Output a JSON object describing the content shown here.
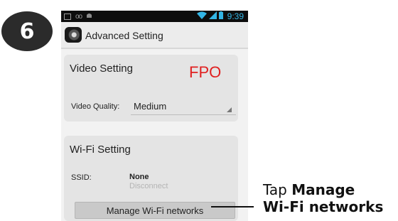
{
  "step_number": "6",
  "statusbar": {
    "left_icons": [
      "picture-icon",
      "voicemail-icon",
      "android-debug-icon"
    ],
    "right_icons": [
      "wifi-icon",
      "signal-icon",
      "battery-icon"
    ],
    "voicemail_glyph": "oo",
    "time": "9:39"
  },
  "actionbar": {
    "title": "Advanced Setting"
  },
  "video_setting": {
    "title": "Video Setting",
    "fpo": "FPO",
    "quality_label": "Video Quality:",
    "quality_value": "Medium"
  },
  "wifi_setting": {
    "title": "Wi-Fi Setting",
    "ssid_label": "SSID:",
    "ssid_value": "None",
    "ssid_action": "Disconnect",
    "manage_button": "Manage Wi-Fi networks"
  },
  "callout": {
    "prefix": "Tap ",
    "bold_1": "Manage",
    "bold_2": "Wi-Fi networks"
  },
  "colors": {
    "accent_blue": "#33b5e5",
    "fpo_red": "#e02020",
    "badge": "#2b2b2b"
  }
}
